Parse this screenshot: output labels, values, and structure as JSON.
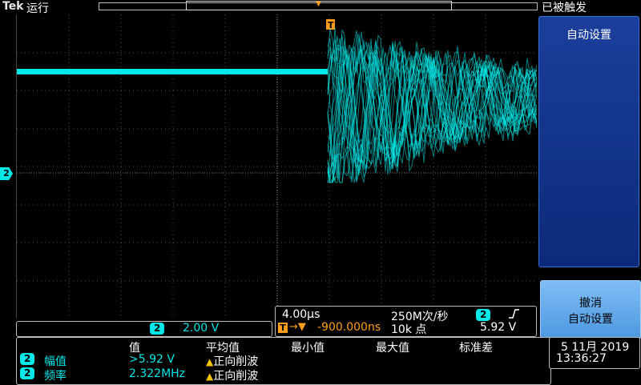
{
  "topbar": {
    "brand": "Tek",
    "run_state": "运行",
    "trigger_status": "已被触发"
  },
  "side_menu": {
    "top_button": "自动设置",
    "bottom_button_line1": "撤消",
    "bottom_button_line2": "自动设置"
  },
  "channel": {
    "marker": "2",
    "badge": "2",
    "scale": "2.00 V",
    "trace_color": "#00e8e8"
  },
  "timebase": {
    "horizontal_scale": "4.00µs",
    "sample_rate": "250M次/秒",
    "trigger_channel": "2",
    "slope_icon": "rising-edge-icon",
    "trigger_marker": "T",
    "arrows": "→▼",
    "position": "-900.000ns",
    "record_length": "10k 点",
    "trigger_level": "5.92 V"
  },
  "measurements": {
    "headers": [
      "值",
      "平均值",
      "最小值",
      "最大值",
      "标准差"
    ],
    "rows": [
      {
        "channel": "2",
        "name": "幅值",
        "value": ">5.92 V",
        "warning": "正向削波"
      },
      {
        "channel": "2",
        "name": "频率",
        "value": "2.322MHz",
        "warning": "正向削波"
      }
    ]
  },
  "datetime": {
    "date": "5 11月 2019",
    "time": "13:36:27"
  },
  "colors": {
    "accent_cyan": "#00e8e8",
    "trigger_orange": "#ff9d1a",
    "menu_blue": "#1a3f9b"
  }
}
